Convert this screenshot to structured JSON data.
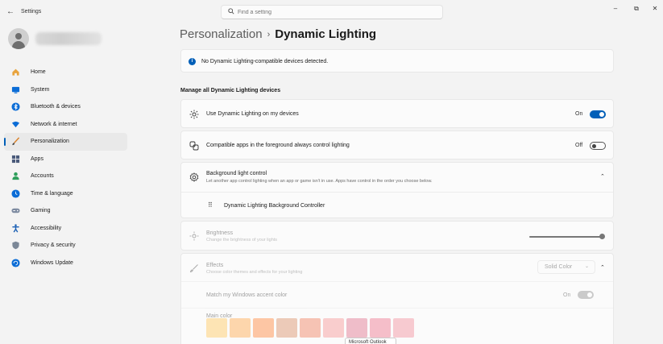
{
  "window": {
    "title": "Settings",
    "back_glyph": "←",
    "min_glyph": "–",
    "max_glyph": "⧉",
    "close_glyph": "✕"
  },
  "search": {
    "placeholder": "Find a setting"
  },
  "sidebar": {
    "items": [
      {
        "label": "Home",
        "icon": "home-icon",
        "color": "#e8a33d"
      },
      {
        "label": "System",
        "icon": "system-icon",
        "color": "#0a6cd6"
      },
      {
        "label": "Bluetooth & devices",
        "icon": "bluetooth-icon",
        "color": "#0a6cd6"
      },
      {
        "label": "Network & internet",
        "icon": "network-icon",
        "color": "#0a6cd6"
      },
      {
        "label": "Personalization",
        "icon": "personalization-icon",
        "color": "#d9822b",
        "active": true
      },
      {
        "label": "Apps",
        "icon": "apps-icon",
        "color": "#4a5a7a"
      },
      {
        "label": "Accounts",
        "icon": "accounts-icon",
        "color": "#2e9e5b"
      },
      {
        "label": "Time & language",
        "icon": "time-language-icon",
        "color": "#0a6cd6"
      },
      {
        "label": "Gaming",
        "icon": "gaming-icon",
        "color": "#7d8aa0"
      },
      {
        "label": "Accessibility",
        "icon": "accessibility-icon",
        "color": "#1a5fb4"
      },
      {
        "label": "Privacy & security",
        "icon": "shield-icon",
        "color": "#7b8797"
      },
      {
        "label": "Windows Update",
        "icon": "windows-update-icon",
        "color": "#0a6cd6"
      }
    ]
  },
  "breadcrumb": {
    "parent": "Personalization",
    "separator": "›",
    "current": "Dynamic Lighting"
  },
  "info_bar": {
    "text": "No Dynamic Lighting-compatible devices detected.",
    "icon": "info-icon"
  },
  "section": {
    "title": "Manage all Dynamic Lighting devices"
  },
  "settings": {
    "use_dynamic": {
      "label": "Use Dynamic Lighting on my devices",
      "state": "On"
    },
    "foreground": {
      "label": "Compatible apps in the foreground always control lighting",
      "state": "Off"
    },
    "background": {
      "label": "Background light control",
      "sub": "Let another app control lighting when an app or game isn't in use. Apps have control in the order you choose below.",
      "controller": "Dynamic Lighting Background Controller"
    },
    "brightness": {
      "label": "Brightness",
      "sub": "Change the brightness of your lights",
      "value": 100
    },
    "effects": {
      "label": "Effects",
      "sub": "Choose color themes and effects for your lighting",
      "selected": "Solid Color"
    },
    "accent": {
      "label": "Match my Windows accent color",
      "state": "On"
    },
    "main_color": {
      "label": "Main color"
    }
  },
  "colors": {
    "accent": "#005fb8",
    "swatches": [
      "#ffd27a",
      "#ffb86b",
      "#ff9a5c",
      "#e0a382",
      "#f2957a",
      "#f7a8a8",
      "#e58aa0",
      "#f08da0",
      "#f4a3ad"
    ]
  },
  "tooltip": {
    "text": "Microsoft Outlook"
  }
}
